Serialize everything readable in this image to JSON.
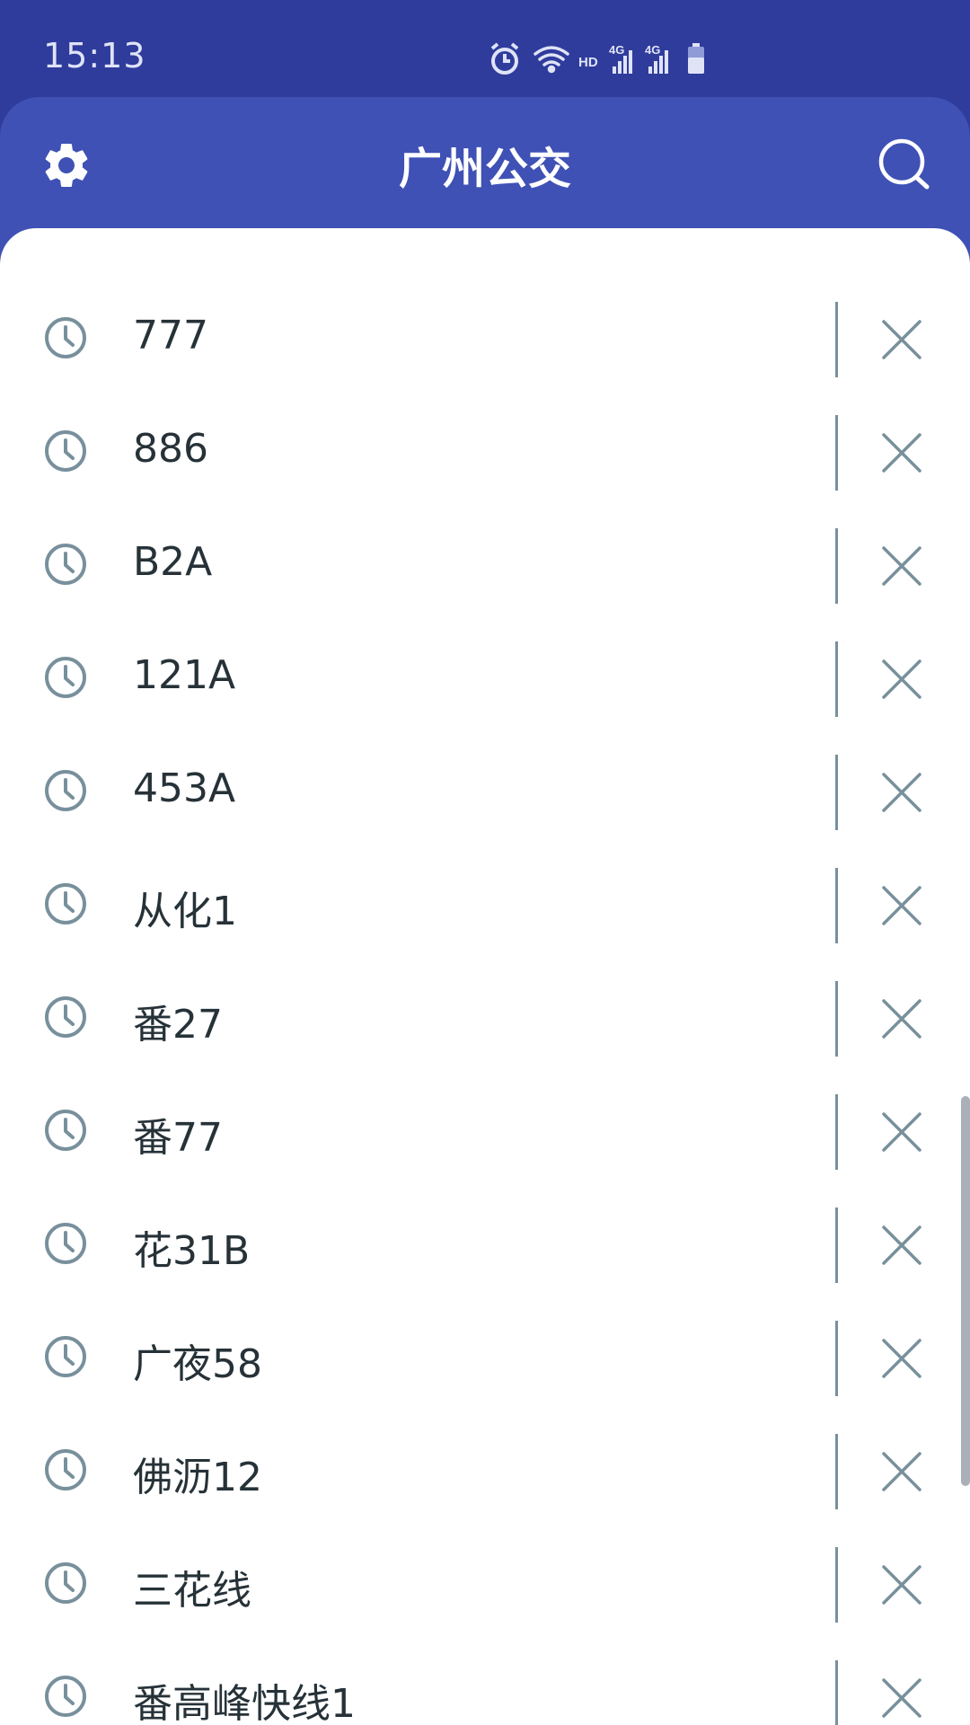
{
  "status_bar": {
    "time": "15:13",
    "icons": [
      "alarm-icon",
      "wifi-icon",
      "hd-icon",
      "signal-4g-icon",
      "signal-4g-icon",
      "battery-icon"
    ],
    "hd_label": "HD",
    "network_label": "4G"
  },
  "app_bar": {
    "title": "广州公交",
    "left_icon": "gear-icon",
    "right_icon": "search-icon",
    "color": "#3f51b5"
  },
  "history": {
    "items": [
      {
        "label": "777"
      },
      {
        "label": "886"
      },
      {
        "label": "B2A"
      },
      {
        "label": "121A"
      },
      {
        "label": "453A"
      },
      {
        "label": "从化1"
      },
      {
        "label": "番27"
      },
      {
        "label": "番77"
      },
      {
        "label": "花31B"
      },
      {
        "label": "广夜58"
      },
      {
        "label": "佛沥12"
      },
      {
        "label": "三花线"
      },
      {
        "label": "番高峰快线1"
      }
    ],
    "item_icon": "clock-icon",
    "delete_icon": "close-icon",
    "icon_color": "#78909c"
  },
  "colors": {
    "status_bar": "#2f3c9c",
    "app_bar": "#3f51b5",
    "text": "#263238",
    "icon": "#78909c"
  }
}
